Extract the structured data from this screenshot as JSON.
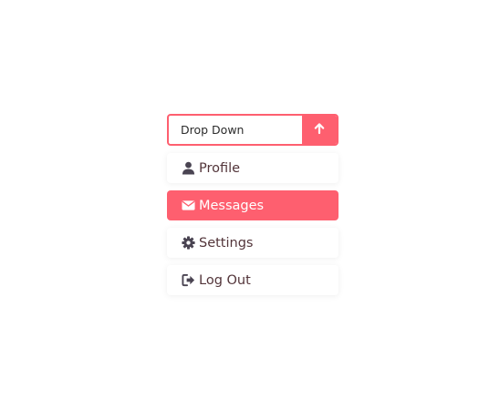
{
  "dropdown": {
    "label": "Drop Down",
    "toggle_icon": "arrow-up-icon",
    "accent_color": "#fe5f6f",
    "items": [
      {
        "label": "Profile",
        "icon": "user-icon",
        "active": false
      },
      {
        "label": "Messages",
        "icon": "envelope-icon",
        "active": true
      },
      {
        "label": "Settings",
        "icon": "gear-icon",
        "active": false
      },
      {
        "label": "Log Out",
        "icon": "sign-out-icon",
        "active": false
      }
    ]
  }
}
